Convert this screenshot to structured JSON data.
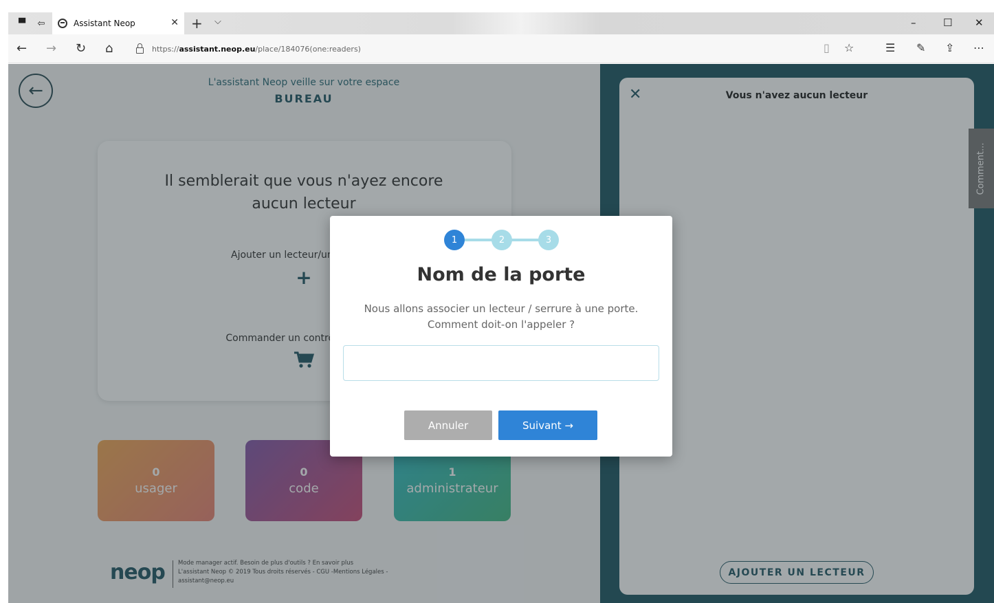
{
  "browser": {
    "tab_title": "Assistant Neop",
    "url_prefix": "https://",
    "url_domain": "assistant.neop.eu",
    "url_path": "/place/184076(one:readers)",
    "icons": [
      "back-arrow-icon",
      "forward-arrow-icon",
      "refresh-icon",
      "home-icon",
      "lock-icon",
      "reading-view-icon",
      "favorite-star-icon",
      "favorites-list-icon",
      "pen-icon",
      "share-icon",
      "more-icon"
    ]
  },
  "page": {
    "header_line1": "L'assistant Neop veille sur votre espace",
    "space_name": "BUREAU",
    "card": {
      "title": "Il semblerait que vous n'ayez encore aucun lecteur",
      "add_reader_label": "Ajouter un lecteur/une serrure",
      "add_icon": "+",
      "order_label": "Commander un contrôle d'accès"
    },
    "tiles": [
      {
        "count": "0",
        "label": "usager"
      },
      {
        "count": "0",
        "label": "code"
      },
      {
        "count": "1",
        "label": "administrateur"
      }
    ],
    "footer": {
      "logo": "neop",
      "line1": "Mode manager actif. Besoin de plus d'outils ? En savoir plus",
      "line2": "L'assistant Neop © 2019 Tous droits réservés - CGU -Mentions Légales -",
      "line3": "assistant@neop.eu"
    }
  },
  "panel": {
    "title": "Vous n'avez aucun lecteur",
    "add_button": "AJOUTER UN LECTEUR"
  },
  "comment_tab": "Comment...",
  "modal": {
    "steps": [
      "1",
      "2",
      "3"
    ],
    "current_step": 1,
    "title": "Nom de la porte",
    "desc_line1": "Nous allons associer un lecteur / serrure à une porte.",
    "desc_line2": "Comment doit-on l'appeler ?",
    "input_value": "",
    "cancel_label": "Annuler",
    "next_label": "Suivant →"
  },
  "colors": {
    "brand_dark": "#124b59",
    "panel_bg": "#0f4a58",
    "primary_blue": "#2f84d7",
    "step_inactive": "#a7dce8"
  }
}
